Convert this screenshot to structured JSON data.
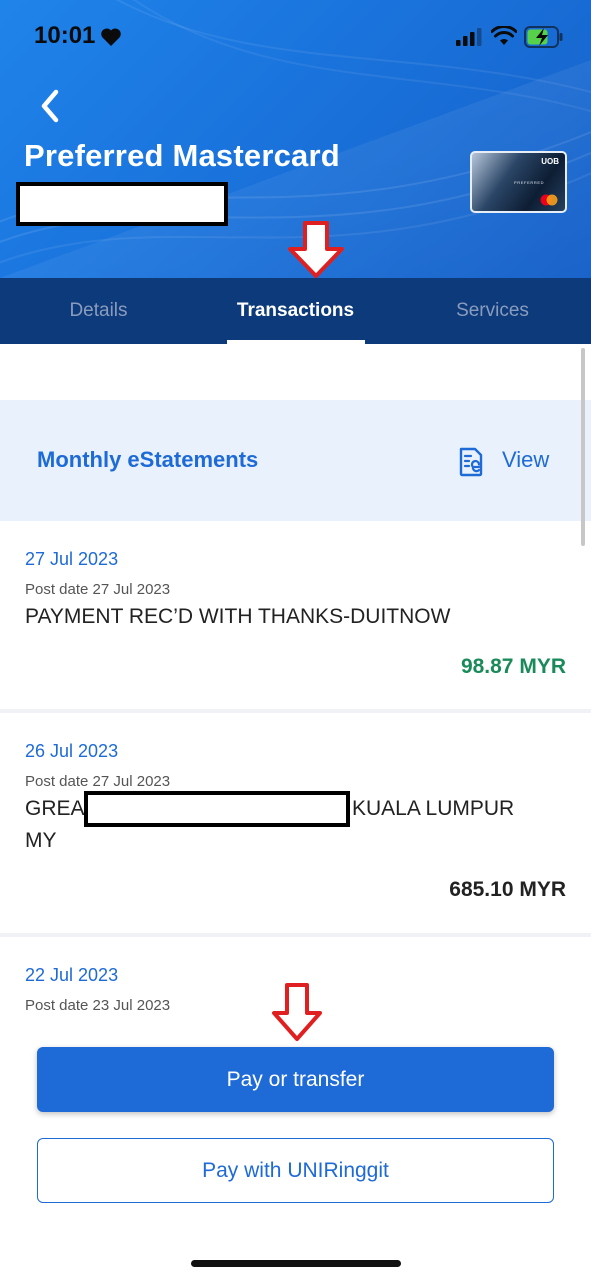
{
  "status_bar": {
    "time": "10:01"
  },
  "header": {
    "title": "Preferred Mastercard",
    "card_brand": "UOB",
    "card_tier": "PREFERRED"
  },
  "tabs": [
    {
      "label": "Details",
      "active": false
    },
    {
      "label": "Transactions",
      "active": true
    },
    {
      "label": "Services",
      "active": false
    }
  ],
  "estatement": {
    "label": "Monthly eStatements",
    "action": "View",
    "icon": "document-e-icon"
  },
  "transactions": [
    {
      "date": "27 Jul 2023",
      "post_date": "Post date 27 Jul 2023",
      "description": "PAYMENT REC’D WITH THANKS-DUITNOW",
      "amount": "98.87 MYR",
      "amount_color": "#1a8a5a"
    },
    {
      "date": "26 Jul 2023",
      "post_date": "Post date 27 Jul 2023",
      "description_start": "GREA",
      "description_end": "KUALA LUMPUR",
      "description_line2": "MY",
      "amount": "685.10 MYR",
      "amount_color": "#222222"
    },
    {
      "date": "22 Jul 2023",
      "post_date": "Post date 23 Jul 2023"
    }
  ],
  "buttons": {
    "pay_transfer": "Pay or transfer",
    "pay_uniringgit": "Pay with UNIRinggit"
  },
  "colors": {
    "brand_blue": "#1e6ad6",
    "tab_bar": "#0d3a7a",
    "annotation_arrow": "#e02020"
  }
}
